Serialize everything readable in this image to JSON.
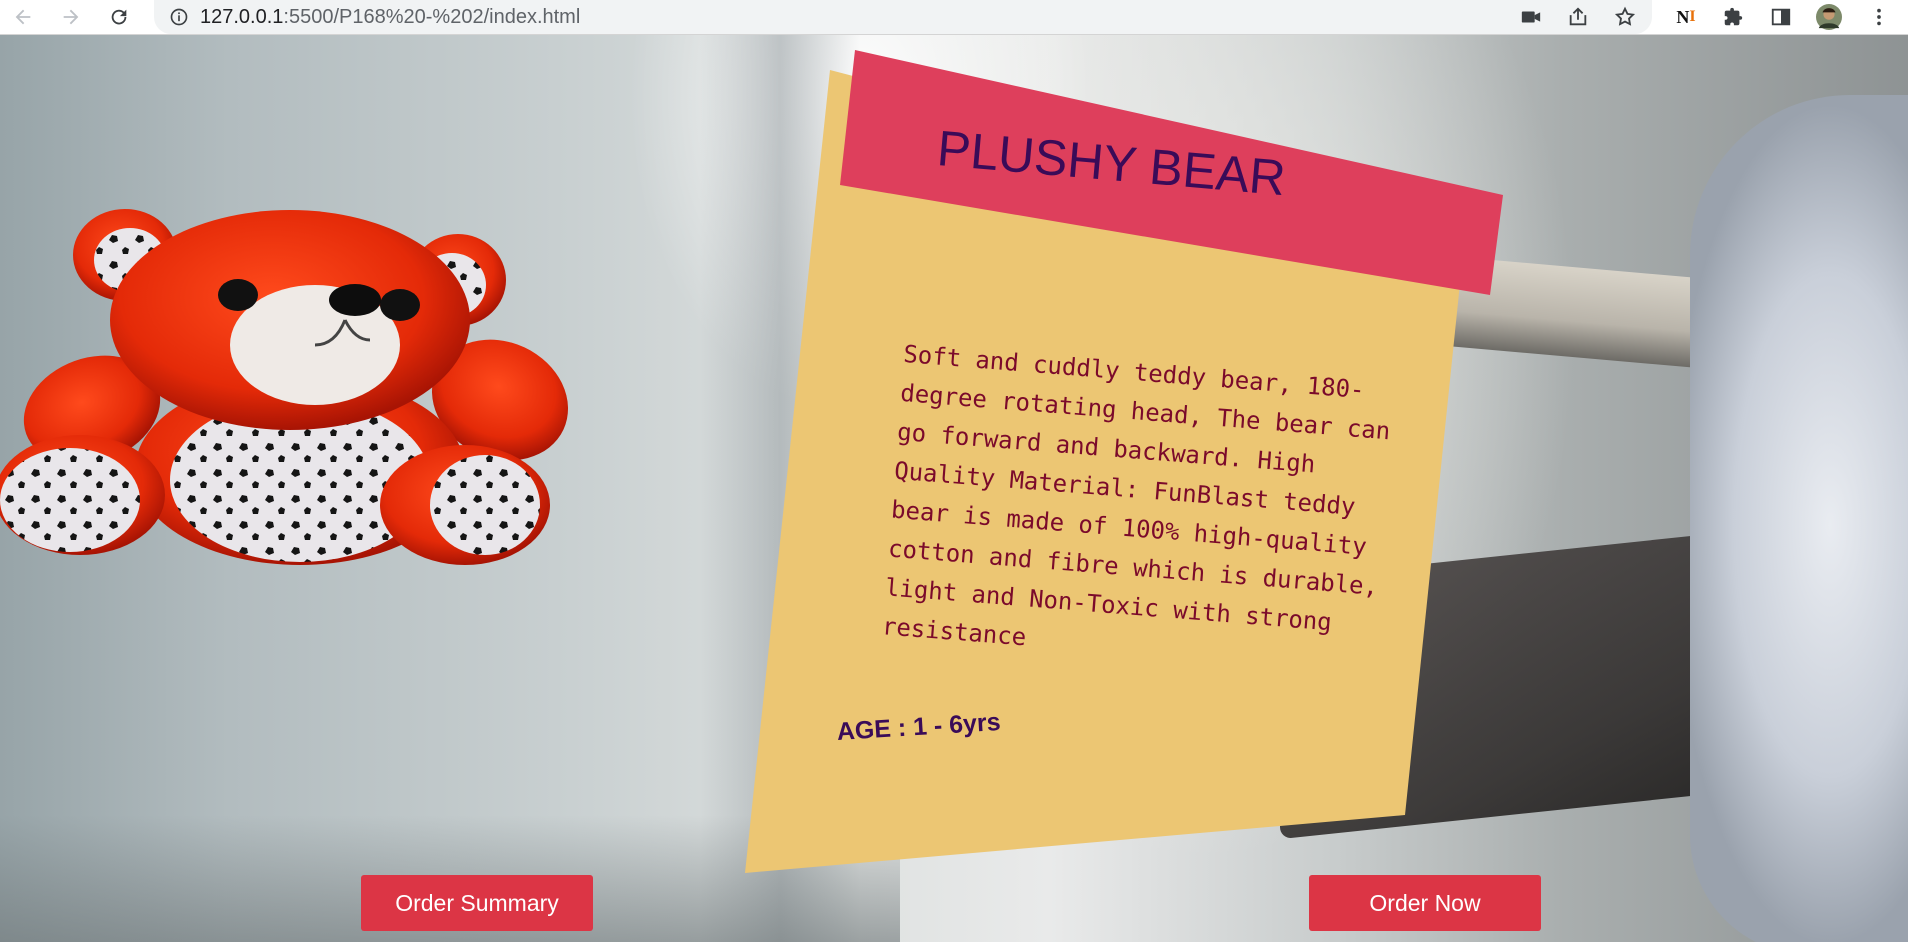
{
  "browser": {
    "url_host": "127.0.0.1",
    "url_path": ":5500/P168%20-%202/index.html",
    "extension_label": "N"
  },
  "product": {
    "title": "PLUSHY BEAR",
    "description": "Soft and cuddly teddy bear, 180-degree rotating head, The bear can go forward and backward. High Quality Material: FunBlast teddy bear is made of 100% high-quality cotton and fibre which is durable, light and Non-Toxic with strong resistance",
    "age": "AGE : 1 - 6yrs"
  },
  "actions": {
    "order_summary_label": "Order Summary",
    "order_now_label": "Order Now"
  },
  "colors": {
    "card": "#ecc673",
    "banner": "#de3f5c",
    "title_text": "#3a0b58",
    "description_text": "#7b0a2b",
    "button": "#dc3545"
  }
}
